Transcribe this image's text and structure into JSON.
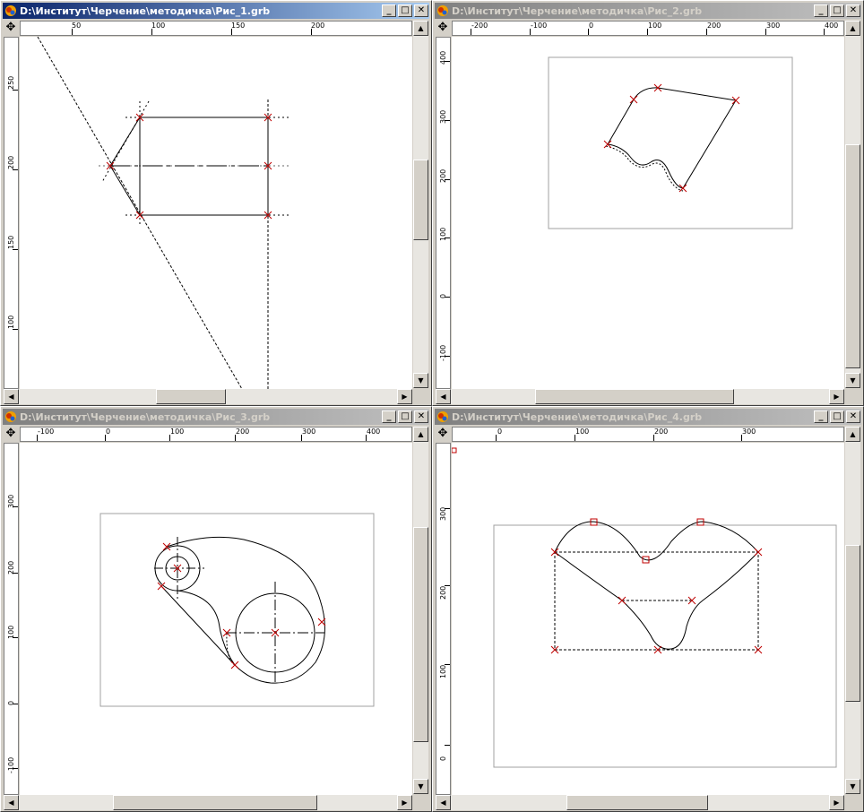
{
  "windows": [
    {
      "id": "w1",
      "title": "D:\\Институт\\Черчение\\методичка\\Рис_1.grb",
      "active": true,
      "hruler_labels": [
        {
          "t": "50"
        },
        {
          "t": "100"
        },
        {
          "t": "150"
        },
        {
          "t": "200"
        }
      ],
      "vruler_labels": [
        {
          "t": "250"
        },
        {
          "t": "200"
        },
        {
          "t": "150"
        },
        {
          "t": "100"
        }
      ]
    },
    {
      "id": "w2",
      "title": "D:\\Институт\\Черчение\\методичка\\Рис_2.grb",
      "active": false,
      "hruler_labels": [
        {
          "t": "-200"
        },
        {
          "t": "-100"
        },
        {
          "t": "0"
        },
        {
          "t": "100"
        },
        {
          "t": "200"
        },
        {
          "t": "300"
        },
        {
          "t": "400"
        }
      ],
      "vruler_labels": [
        {
          "t": "400"
        },
        {
          "t": "300"
        },
        {
          "t": "200"
        },
        {
          "t": "100"
        },
        {
          "t": "0"
        },
        {
          "t": "-100"
        }
      ]
    },
    {
      "id": "w3",
      "title": "D:\\Институт\\Черчение\\методичка\\Рис_3.grb",
      "active": false,
      "hruler_labels": [
        {
          "t": "-100"
        },
        {
          "t": "0"
        },
        {
          "t": "100"
        },
        {
          "t": "200"
        },
        {
          "t": "300"
        },
        {
          "t": "400"
        }
      ],
      "vruler_labels": [
        {
          "t": "300"
        },
        {
          "t": "200"
        },
        {
          "t": "100"
        },
        {
          "t": "0"
        },
        {
          "t": "-100"
        }
      ]
    },
    {
      "id": "w4",
      "title": "D:\\Институт\\Черчение\\методичка\\Рис_4.grb",
      "active": false,
      "hruler_labels": [
        {
          "t": "0"
        },
        {
          "t": "100"
        },
        {
          "t": "200"
        },
        {
          "t": "300"
        }
      ],
      "vruler_labels": [
        {
          "t": "300"
        },
        {
          "t": "200"
        },
        {
          "t": "100"
        },
        {
          "t": "0"
        }
      ]
    }
  ],
  "buttons": {
    "minimize": "_",
    "maximize": "□",
    "close": "✕"
  },
  "icons": {
    "app": "app-logo-icon",
    "pan": "move-crosshair-icon"
  },
  "colors": {
    "active_title": "#0a246a",
    "inactive_title": "#808080",
    "marker": "#c00000"
  }
}
